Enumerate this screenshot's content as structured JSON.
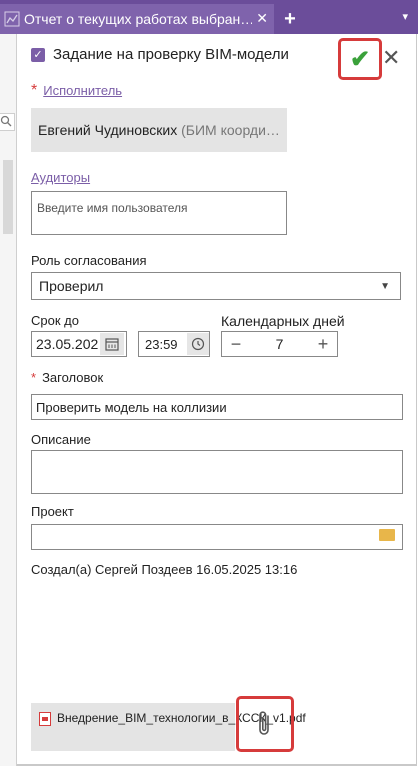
{
  "tab": {
    "title": "Отчет о текущих работах выбран…",
    "close": "✕",
    "add": "+",
    "menu": "▾"
  },
  "task": {
    "title": "Задание на проверку BIM-модели",
    "checked": true
  },
  "executor": {
    "label": "Исполнитель",
    "name": "Евгений Чудиновских",
    "role": "(БИМ коорди…"
  },
  "auditors": {
    "label": "Аудиторы",
    "placeholder": "Введите имя пользователя"
  },
  "role": {
    "label": "Роль согласования",
    "value": "Проверил"
  },
  "due": {
    "label": "Срок до",
    "date": "23.05.202",
    "time": "23:59"
  },
  "days": {
    "label": "Календарных дней",
    "value": "7",
    "minus": "−",
    "plus": "+"
  },
  "title_field": {
    "label": "Заголовок",
    "value": "Проверить модель на коллизии"
  },
  "description": {
    "label": "Описание"
  },
  "project": {
    "label": "Проект"
  },
  "created": "Создал(а) Сергей Поздеев 16.05.2025 13:16",
  "attachment": {
    "name": "Внедрение_BIM_технологии_в_КССК_v1.pdf"
  },
  "colors": {
    "accent": "#7b5ea7",
    "tabbar": "#6b4d9a",
    "highlight": "#d63b3b",
    "confirm": "#3aa13a"
  }
}
